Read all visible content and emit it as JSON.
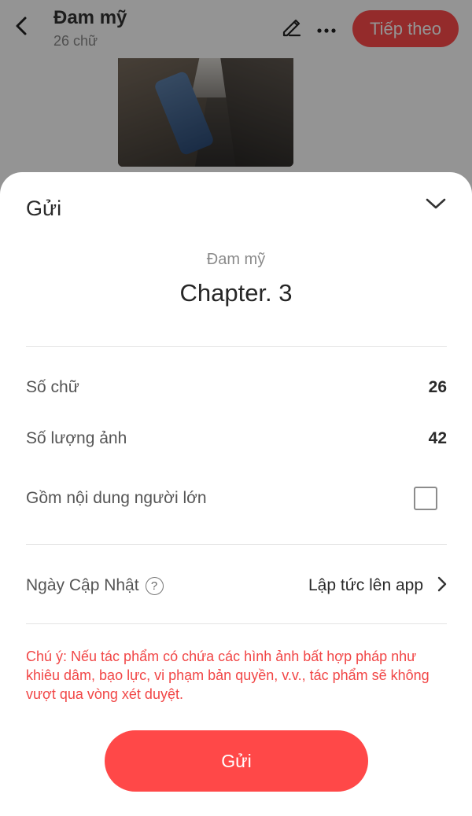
{
  "header": {
    "title": "Đam mỹ",
    "subtitle": "26 chữ",
    "next_label": "Tiếp theo",
    "back_icon": "chevron-left-icon",
    "edit_icon": "pencil-icon",
    "more_icon": "more-horizontal-icon"
  },
  "sheet": {
    "title": "Gửi",
    "collapse_icon": "chevron-down-icon",
    "work_name": "Đam mỹ",
    "chapter": "Chapter. 3",
    "rows": {
      "word_count": {
        "label": "Số chữ",
        "value": "26"
      },
      "image_count": {
        "label": "Số lượng ảnh",
        "value": "42"
      },
      "adult": {
        "label": "Gồm nội dung người lớn",
        "checked": false
      }
    },
    "update": {
      "label": "Ngày Cập Nhật",
      "help_icon": "question-circle-icon",
      "value": "Lập tức lên app",
      "chevron_icon": "chevron-right-icon"
    },
    "notice": "Chú ý: Nếu tác phẩm có chứa các hình ảnh bất hợp pháp như khiêu dâm, bạo lực, vi phạm bản quyền, v.v., tác phẩm sẽ không vượt qua vòng xét duyệt.",
    "submit_label": "Gửi"
  },
  "colors": {
    "accent": "#ff4848",
    "notice": "#f14646",
    "overlay": "rgba(0,0,0,0.42)"
  }
}
